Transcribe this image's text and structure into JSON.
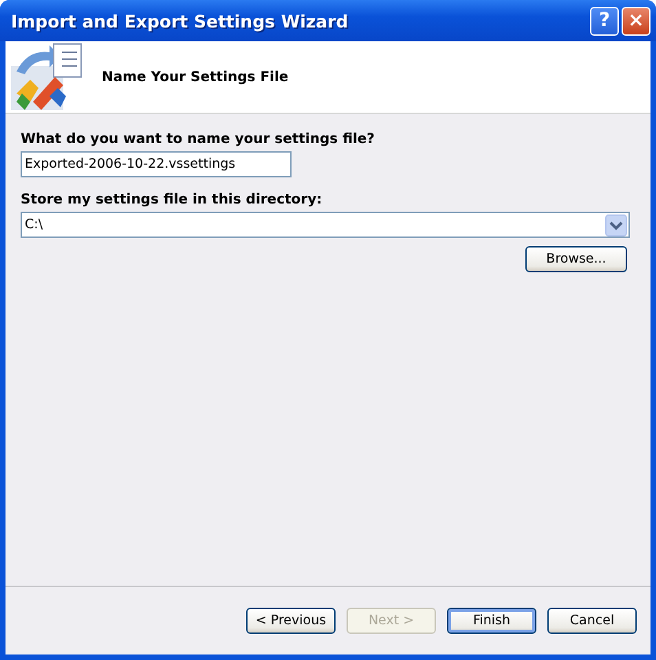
{
  "window": {
    "title": "Import and Export Settings Wizard",
    "title_buttons": [
      "?",
      "×"
    ]
  },
  "header": {
    "title": "Name Your Settings File"
  },
  "name_field": {
    "label": "What do you want to name your settings file?",
    "value": "Exported-2006-10-22.vssettings"
  },
  "directory_field": {
    "label": "Store my settings file in this directory:",
    "value": "C:\\"
  },
  "browse_button": {
    "label": "Browse..."
  },
  "buttons": [
    {
      "label": "< Previous",
      "disabled": false,
      "default": false
    },
    {
      "label": "Next >",
      "disabled": true,
      "default": false
    },
    {
      "label": "Finish",
      "disabled": false,
      "default": true
    },
    {
      "label": "Cancel",
      "disabled": false,
      "default": false
    }
  ]
}
